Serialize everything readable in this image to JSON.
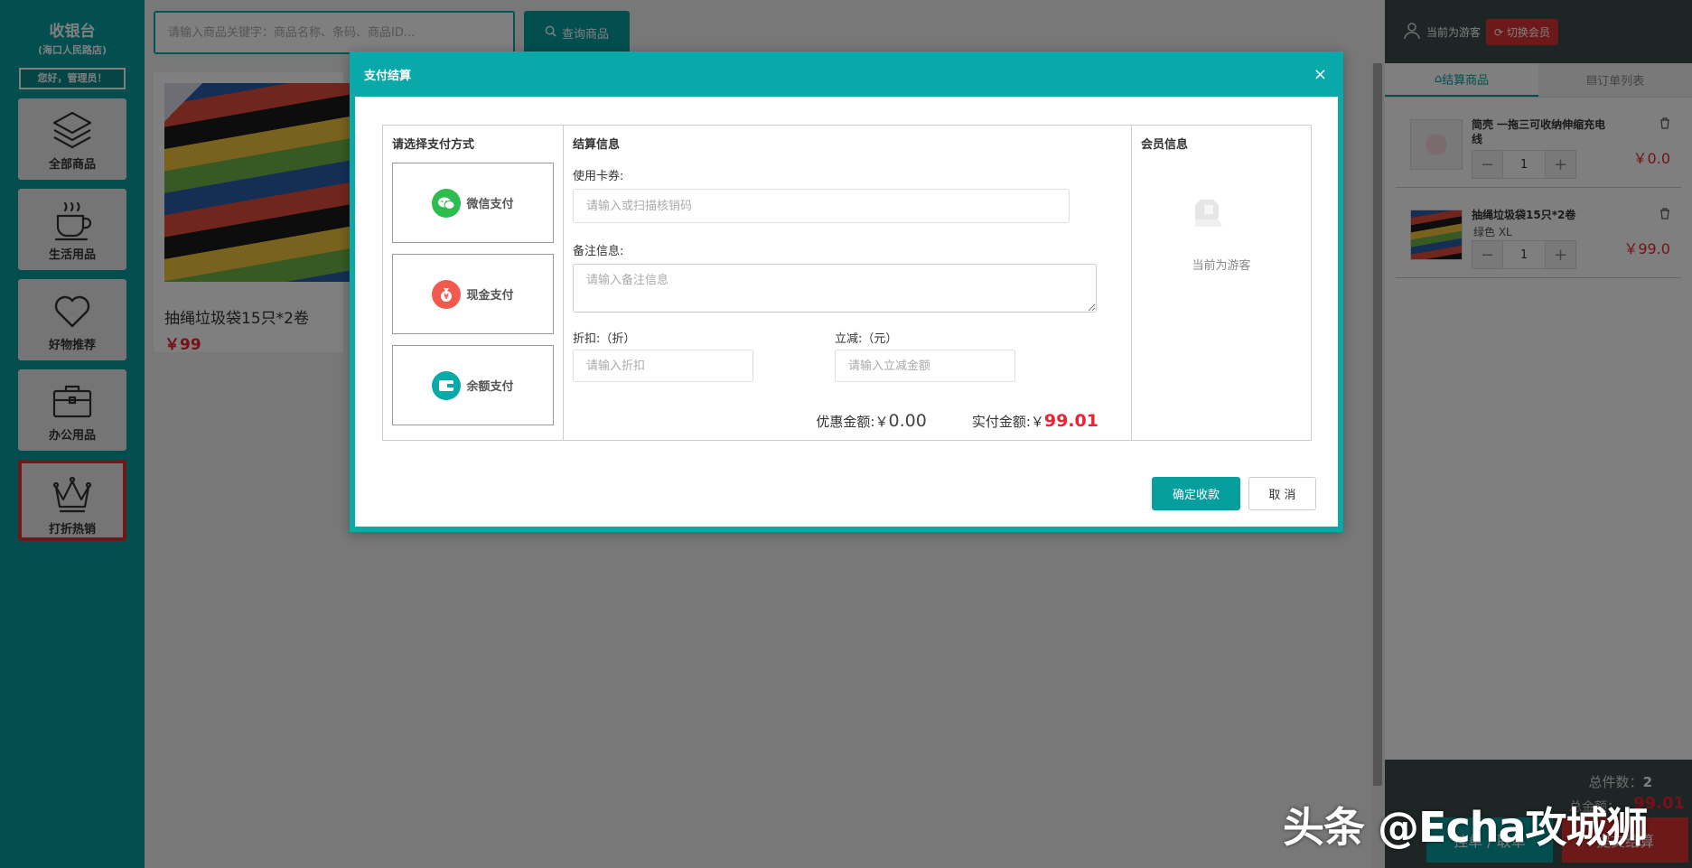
{
  "brand": {
    "title": "收银台",
    "store": "(海口人民路店)",
    "greeting": "您好，管理员！"
  },
  "nav": {
    "items": [
      {
        "label": "全部商品",
        "icon": "layers-icon"
      },
      {
        "label": "生活用品",
        "icon": "coffee-cup-icon"
      },
      {
        "label": "好物推荐",
        "icon": "heart-icon"
      },
      {
        "label": "办公用品",
        "icon": "briefcase-icon"
      },
      {
        "label": "打折热销",
        "icon": "crown-icon",
        "active": true
      }
    ]
  },
  "search": {
    "placeholder": "请输入商品关键字：商品名称、条码、商品ID...",
    "value": "",
    "button_label": "查询商品"
  },
  "products": [
    {
      "name": "抽绳垃圾袋15只*2卷",
      "price": "￥99"
    }
  ],
  "cart": {
    "user_label": "当前为游客",
    "switch_member_label": "切换会员",
    "tabs": [
      {
        "label": "结算商品",
        "active": true
      },
      {
        "label": "订单列表",
        "active": false
      }
    ],
    "items": [
      {
        "name": "简壳 一拖三可收纳伸缩充电线",
        "spec": "",
        "qty": "1",
        "price": "￥0.0"
      },
      {
        "name": "抽绳垃圾袋15只*2卷",
        "spec": "绿色  XL",
        "qty": "1",
        "price": "￥99.0"
      }
    ],
    "total_count_label": "总件数：",
    "total_count": "2",
    "total_amount_label": "总金额：",
    "total_amount": "99.01",
    "hold_label": "挂单 / 取单",
    "submit_label": "提交结算"
  },
  "modal": {
    "title": "支付结算",
    "close_label": "×",
    "payment": {
      "title": "请选择支付方式",
      "options": [
        {
          "label": "微信支付",
          "icon": "wechat-icon",
          "color": "#2dbd4e"
        },
        {
          "label": "现金支付",
          "icon": "money-bag-icon",
          "color": "#f25a4d"
        },
        {
          "label": "余额支付",
          "icon": "wallet-icon",
          "color": "#0aa9a9"
        }
      ]
    },
    "info": {
      "title": "结算信息",
      "coupon_label": "使用卡券:",
      "coupon_placeholder": "请输入或扫描核销码",
      "note_label": "备注信息:",
      "note_placeholder": "请输入备注信息",
      "discount_label": "折扣:（折）",
      "discount_placeholder": "请输入折扣",
      "reduce_label": "立减:（元）",
      "reduce_placeholder": "请输入立减金额",
      "saved_label": "优惠金额:",
      "saved_currency": "￥",
      "saved_value": "0.00",
      "pay_label": "实付金额:",
      "pay_currency": "￥",
      "pay_value": "99.01"
    },
    "member": {
      "title": "会员信息",
      "status": "当前为游客"
    },
    "confirm_label": "确定收款",
    "cancel_label": "取 消"
  },
  "watermark": "头条 @Echa攻城狮",
  "colors": {
    "accent": "#079e9e",
    "danger": "#dd3333",
    "dark_panel": "#3c4b4b"
  }
}
